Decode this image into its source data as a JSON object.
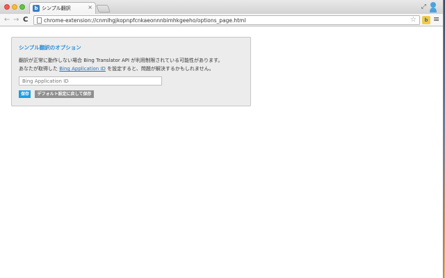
{
  "browser": {
    "tab_title": "シンプル翻訳",
    "tab_close": "×",
    "url": "chrome-extension://cnmlhgjkopnpfcnkaeonnnbimhkgeeho/options_page.html",
    "icons": [
      "back-arrow-icon",
      "forward-arrow-icon",
      "reload-icon",
      "page-icon",
      "star-icon",
      "extension-icon",
      "menu-icon",
      "fullscreen-icon",
      "profile-icon"
    ]
  },
  "options": {
    "title": "シンプル翻訳のオプション",
    "desc_line1": "翻訳が正常に動作しない場合 Bing Translator API が利用制限されている可能性があります。",
    "desc_line2_pre": "あなたが取得した ",
    "desc_link": "Bing Application ID",
    "desc_line2_post": " を設定すると、問題が解決するかもしれません。",
    "input_placeholder": "Bing Application ID",
    "input_value": "",
    "save_label": "保存",
    "default_label": "デフォルト設定に戻して保存"
  },
  "colors": {
    "accent": "#2a8fd8",
    "save_button": "#1a9ee6",
    "default_button": "#8f8f8f"
  }
}
